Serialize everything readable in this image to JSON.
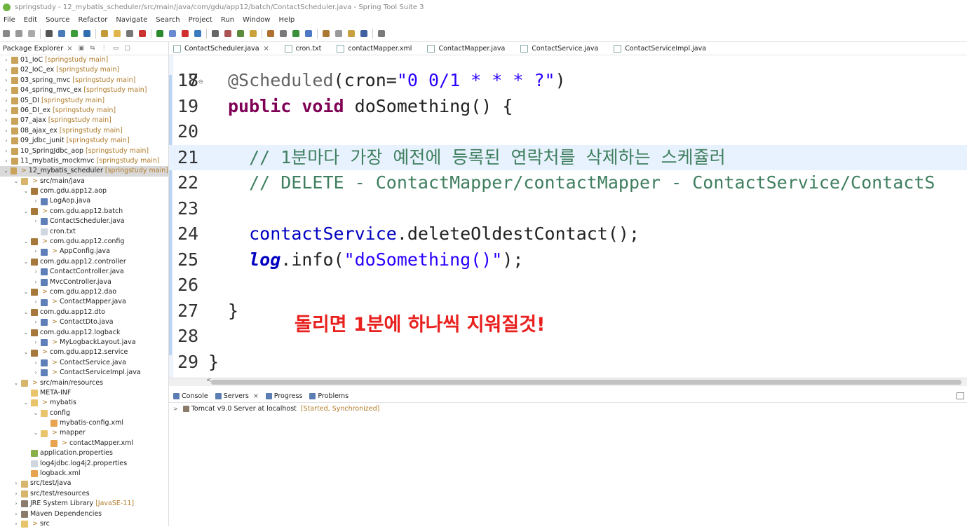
{
  "window": {
    "title": "springstudy - 12_mybatis_scheduler/src/main/java/com/gdu/app12/batch/ContactScheduler.java - Spring Tool Suite 3"
  },
  "menu": [
    "File",
    "Edit",
    "Source",
    "Refactor",
    "Navigate",
    "Search",
    "Project",
    "Run",
    "Window",
    "Help"
  ],
  "explorer": {
    "title": "Package Explorer",
    "items": [
      {
        "indent": 0,
        "tw": ">",
        "icon": "proj",
        "dec": "",
        "name": "01_IoC",
        "meta": "[springstudy main]"
      },
      {
        "indent": 0,
        "tw": ">",
        "icon": "proj",
        "dec": "",
        "name": "02_IoC_ex",
        "meta": "[springstudy main]"
      },
      {
        "indent": 0,
        "tw": ">",
        "icon": "proj",
        "dec": "",
        "name": "03_spring_mvc",
        "meta": "[springstudy main]"
      },
      {
        "indent": 0,
        "tw": ">",
        "icon": "proj",
        "dec": "",
        "name": "04_spring_mvc_ex",
        "meta": "[springstudy main]"
      },
      {
        "indent": 0,
        "tw": ">",
        "icon": "proj",
        "dec": "",
        "name": "05_DI",
        "meta": "[springstudy main]"
      },
      {
        "indent": 0,
        "tw": ">",
        "icon": "proj",
        "dec": "",
        "name": "06_DI_ex",
        "meta": "[springstudy main]"
      },
      {
        "indent": 0,
        "tw": ">",
        "icon": "proj",
        "dec": "",
        "name": "07_ajax",
        "meta": "[springstudy main]"
      },
      {
        "indent": 0,
        "tw": ">",
        "icon": "proj",
        "dec": "",
        "name": "08_ajax_ex",
        "meta": "[springstudy main]"
      },
      {
        "indent": 0,
        "tw": ">",
        "icon": "proj",
        "dec": "",
        "name": "09_jdbc_junit",
        "meta": "[springstudy main]"
      },
      {
        "indent": 0,
        "tw": ">",
        "icon": "proj",
        "dec": "",
        "name": "10_SpringJdbc_aop",
        "meta": "[springstudy main]"
      },
      {
        "indent": 0,
        "tw": ">",
        "icon": "proj",
        "dec": "",
        "name": "11_mybatis_mockmvc",
        "meta": "[springstudy main]"
      },
      {
        "indent": 0,
        "tw": "v",
        "icon": "proj",
        "dec": ">",
        "name": "12_mybatis_scheduler",
        "meta": "[springstudy main]",
        "selected": true
      },
      {
        "indent": 1,
        "tw": "v",
        "icon": "src",
        "dec": ">",
        "name": "src/main/java",
        "meta": ""
      },
      {
        "indent": 2,
        "tw": "v",
        "icon": "pkg",
        "dec": "",
        "name": "com.gdu.app12.aop",
        "meta": ""
      },
      {
        "indent": 3,
        "tw": ">",
        "icon": "java",
        "dec": "",
        "name": "LogAop.java",
        "meta": ""
      },
      {
        "indent": 2,
        "tw": "v",
        "icon": "pkg",
        "dec": ">",
        "name": "com.gdu.app12.batch",
        "meta": ""
      },
      {
        "indent": 3,
        "tw": ">",
        "icon": "java",
        "dec": "",
        "name": "ContactScheduler.java",
        "meta": ""
      },
      {
        "indent": 3,
        "tw": "",
        "icon": "txt",
        "dec": "",
        "name": "cron.txt",
        "meta": ""
      },
      {
        "indent": 2,
        "tw": "v",
        "icon": "pkg",
        "dec": ">",
        "name": "com.gdu.app12.config",
        "meta": ""
      },
      {
        "indent": 3,
        "tw": ">",
        "icon": "java",
        "dec": ">",
        "name": "AppConfig.java",
        "meta": ""
      },
      {
        "indent": 2,
        "tw": "v",
        "icon": "pkg",
        "dec": "",
        "name": "com.gdu.app12.controller",
        "meta": ""
      },
      {
        "indent": 3,
        "tw": ">",
        "icon": "java",
        "dec": "",
        "name": "ContactController.java",
        "meta": ""
      },
      {
        "indent": 3,
        "tw": ">",
        "icon": "java",
        "dec": "",
        "name": "MvcController.java",
        "meta": ""
      },
      {
        "indent": 2,
        "tw": "v",
        "icon": "pkg",
        "dec": ">",
        "name": "com.gdu.app12.dao",
        "meta": ""
      },
      {
        "indent": 3,
        "tw": ">",
        "icon": "java",
        "dec": ">",
        "name": "ContactMapper.java",
        "meta": ""
      },
      {
        "indent": 2,
        "tw": "v",
        "icon": "pkg",
        "dec": "",
        "name": "com.gdu.app12.dto",
        "meta": ""
      },
      {
        "indent": 3,
        "tw": ">",
        "icon": "java",
        "dec": ">",
        "name": "ContactDto.java",
        "meta": ""
      },
      {
        "indent": 2,
        "tw": "v",
        "icon": "pkg",
        "dec": "",
        "name": "com.gdu.app12.logback",
        "meta": ""
      },
      {
        "indent": 3,
        "tw": ">",
        "icon": "java",
        "dec": ">",
        "name": "MyLogbackLayout.java",
        "meta": ""
      },
      {
        "indent": 2,
        "tw": "v",
        "icon": "pkg",
        "dec": ">",
        "name": "com.gdu.app12.service",
        "meta": ""
      },
      {
        "indent": 3,
        "tw": ">",
        "icon": "java",
        "dec": ">",
        "name": "ContactService.java",
        "meta": ""
      },
      {
        "indent": 3,
        "tw": ">",
        "icon": "java",
        "dec": ">",
        "name": "ContactServiceImpl.java",
        "meta": ""
      },
      {
        "indent": 1,
        "tw": "v",
        "icon": "src",
        "dec": ">",
        "name": "src/main/resources",
        "meta": ""
      },
      {
        "indent": 2,
        "tw": "",
        "icon": "folder",
        "dec": "",
        "name": "META-INF",
        "meta": ""
      },
      {
        "indent": 2,
        "tw": "v",
        "icon": "folder",
        "dec": ">",
        "name": "mybatis",
        "meta": ""
      },
      {
        "indent": 3,
        "tw": "v",
        "icon": "folder",
        "dec": "",
        "name": "config",
        "meta": ""
      },
      {
        "indent": 4,
        "tw": "",
        "icon": "xml",
        "dec": "",
        "name": "mybatis-config.xml",
        "meta": ""
      },
      {
        "indent": 3,
        "tw": "v",
        "icon": "folder",
        "dec": ">",
        "name": "mapper",
        "meta": ""
      },
      {
        "indent": 4,
        "tw": "",
        "icon": "xml",
        "dec": ">",
        "name": "contactMapper.xml",
        "meta": ""
      },
      {
        "indent": 2,
        "tw": "",
        "icon": "prop",
        "dec": "",
        "name": "application.properties",
        "meta": ""
      },
      {
        "indent": 2,
        "tw": "",
        "icon": "txt",
        "dec": "",
        "name": "log4jdbc.log4j2.properties",
        "meta": ""
      },
      {
        "indent": 2,
        "tw": "",
        "icon": "xml",
        "dec": "",
        "name": "logback.xml",
        "meta": ""
      },
      {
        "indent": 1,
        "tw": ">",
        "icon": "src",
        "dec": "",
        "name": "src/test/java",
        "meta": ""
      },
      {
        "indent": 1,
        "tw": ">",
        "icon": "src",
        "dec": "",
        "name": "src/test/resources",
        "meta": ""
      },
      {
        "indent": 1,
        "tw": ">",
        "icon": "lib",
        "dec": "",
        "name": "JRE System Library",
        "meta": "[JavaSE-11]"
      },
      {
        "indent": 1,
        "tw": ">",
        "icon": "lib",
        "dec": "",
        "name": "Maven Dependencies",
        "meta": ""
      },
      {
        "indent": 1,
        "tw": ">",
        "icon": "folder",
        "dec": ">",
        "name": "src",
        "meta": ""
      }
    ]
  },
  "tabs": [
    {
      "label": "ContactScheduler.java",
      "active": true
    },
    {
      "label": "cron.txt"
    },
    {
      "label": "contactMapper.xml"
    },
    {
      "label": "ContactMapper.java"
    },
    {
      "label": "ContactService.java"
    },
    {
      "label": "ContactServiceImpl.java"
    }
  ],
  "code": {
    "top_partial_line": "17",
    "lines": [
      {
        "n": "18",
        "marker": "⊖",
        "parts": [
          [
            "anno",
            "@Scheduled"
          ],
          [
            "",
            "(cron="
          ],
          [
            "str",
            "\"0 0/1 * * * ?\""
          ],
          [
            "",
            ")"
          ]
        ]
      },
      {
        "n": "19",
        "parts": [
          [
            "kw",
            "public"
          ],
          [
            "",
            " "
          ],
          [
            "kw",
            "void"
          ],
          [
            "",
            " doSomething() {"
          ]
        ]
      },
      {
        "n": "20",
        "parts": []
      },
      {
        "n": "21",
        "hl": true,
        "parts": [
          [
            "cmt",
            "  // 1분마다 가장 예전에 등록된 연락처를 삭제하는 스케쥴러"
          ]
        ]
      },
      {
        "n": "22",
        "parts": [
          [
            "cmt",
            "  // DELETE - ContactMapper/contactMapper - ContactService/ContactS"
          ]
        ]
      },
      {
        "n": "23",
        "parts": []
      },
      {
        "n": "24",
        "parts": [
          [
            "",
            "  "
          ],
          [
            "fld",
            "contactService"
          ],
          [
            "",
            ".deleteOldestContact();"
          ]
        ]
      },
      {
        "n": "25",
        "parts": [
          [
            "",
            "  "
          ],
          [
            "sfld",
            "log"
          ],
          [
            "",
            ".info("
          ],
          [
            "str",
            "\"doSomething()\""
          ],
          [
            "",
            ");"
          ]
        ]
      },
      {
        "n": "26",
        "parts": []
      },
      {
        "n": "27",
        "parts": [
          [
            "",
            "}"
          ]
        ]
      },
      {
        "n": "28",
        "parts": []
      },
      {
        "n": "29",
        "parts": [
          [
            "",
            "}"
          ]
        ],
        "shift": true
      }
    ],
    "note": "돌리면 1분에 하나씩 지워질것!"
  },
  "bottom": {
    "tabs": [
      "Console",
      "Servers",
      "Progress",
      "Problems"
    ],
    "server": {
      "name": "Tomcat v9.0 Server at localhost",
      "status": "[Started, Synchronized]"
    }
  }
}
